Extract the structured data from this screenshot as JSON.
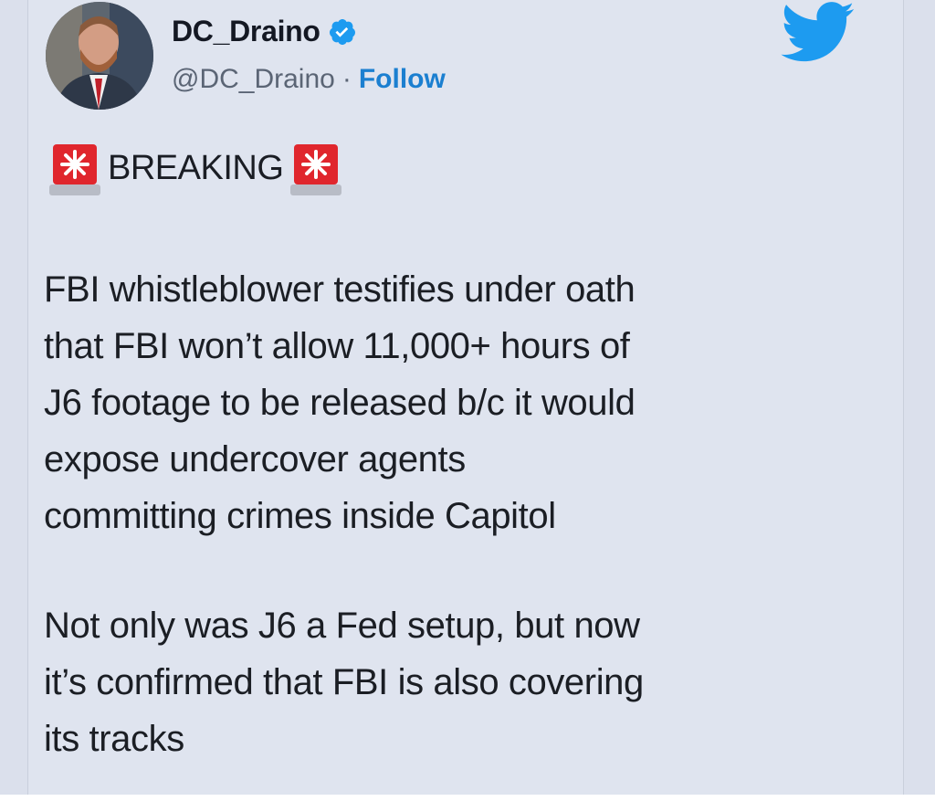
{
  "header": {
    "display_name": "DC_Draino",
    "handle": "@DC_Draino",
    "separator": "·",
    "follow_label": "Follow",
    "verified_icon": "verified-badge-icon",
    "brand_icon": "twitter-bird-icon",
    "brand_color": "#1d9bf0"
  },
  "tweet": {
    "headline": "BREAKING",
    "siren_icon": "rotating-light-icon",
    "paragraph_1_lines": [
      "FBI whistleblower testifies under oath",
      "that FBI won’t allow 11,000+ hours of",
      "J6 footage to be released b/c it would",
      "expose undercover agents",
      "committing crimes inside Capitol"
    ],
    "paragraph_2_lines": [
      "Not only was J6 a Fed setup, but now",
      "it’s confirmed that FBI is also covering",
      "its tracks"
    ]
  }
}
